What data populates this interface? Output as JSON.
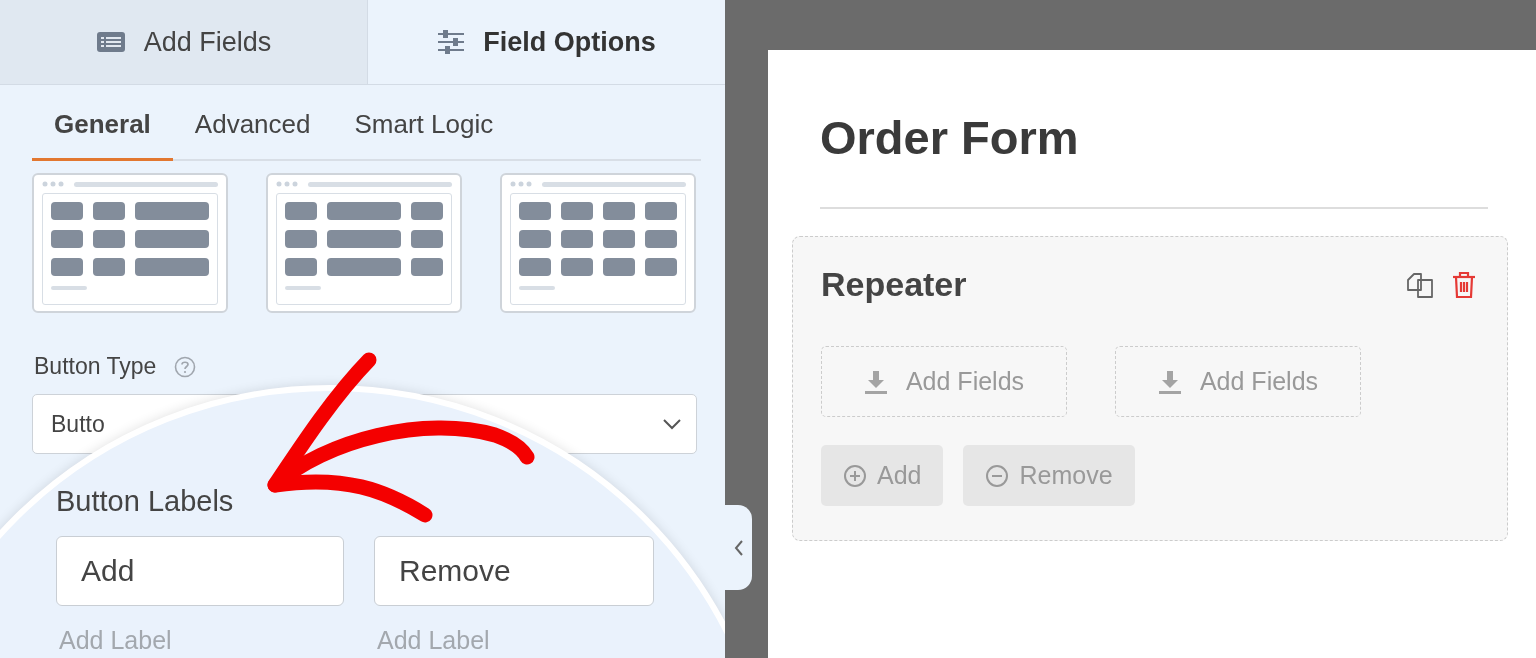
{
  "panel_tabs": [
    {
      "kind": "list",
      "label": "Add Fields",
      "selected": false
    },
    {
      "kind": "sliders",
      "label": "Field Options",
      "selected": true
    }
  ],
  "sub_tabs": [
    {
      "label": "General",
      "selected": true
    },
    {
      "label": "Advanced",
      "selected": false
    },
    {
      "label": "Smart Logic",
      "selected": false
    }
  ],
  "layouts": [
    {
      "kind": "wide-last"
    },
    {
      "kind": "wide-middle"
    },
    {
      "kind": "four-even"
    }
  ],
  "button_type": {
    "label": "Button Type",
    "value": "Butto"
  },
  "magnifier": {
    "label": "Button Labels",
    "fields": [
      {
        "value": "Add",
        "hint": "Add Label"
      },
      {
        "value": "Remove",
        "hint": "Add Label"
      }
    ]
  },
  "form": {
    "title": "Order Form",
    "repeater": {
      "title": "Repeater",
      "drop_zones": [
        "Add Fields",
        "Add Fields"
      ],
      "buttons": [
        {
          "kind": "add",
          "label": "Add"
        },
        {
          "kind": "remove",
          "label": "Remove"
        }
      ]
    }
  }
}
